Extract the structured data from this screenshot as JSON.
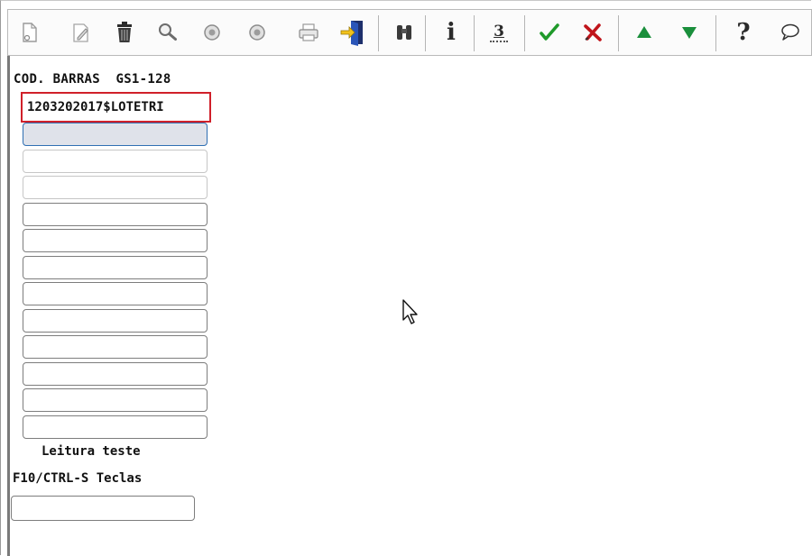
{
  "toolbar": {
    "icons": [
      "new-document-icon",
      "edit-icon",
      "delete-trash-icon",
      "search-icon",
      "circle-button-icon",
      "circle-button-icon",
      "print-icon",
      "exit-door-icon",
      "binoculars-icon",
      "info-icon",
      "count-icon",
      "check-confirm-icon",
      "cancel-x-icon",
      "arrow-up-icon",
      "arrow-down-icon",
      "help-question-icon",
      "chat-bubble-icon"
    ],
    "info_glyph": "i",
    "count_glyph": "3",
    "help_glyph": "?"
  },
  "form": {
    "header_label": "COD. BARRAS  GS1-128",
    "barcode_value": "1203202017$LOTETRI",
    "footer_label": "Leitura teste",
    "keys_label": "F10/CTRL-S Teclas"
  },
  "colors": {
    "highlight_border": "#d0202a",
    "check_green": "#1f9a2a",
    "cancel_red": "#c0151b",
    "arrow_green": "#1a8f3c",
    "focus_border": "#2f6fb3"
  }
}
